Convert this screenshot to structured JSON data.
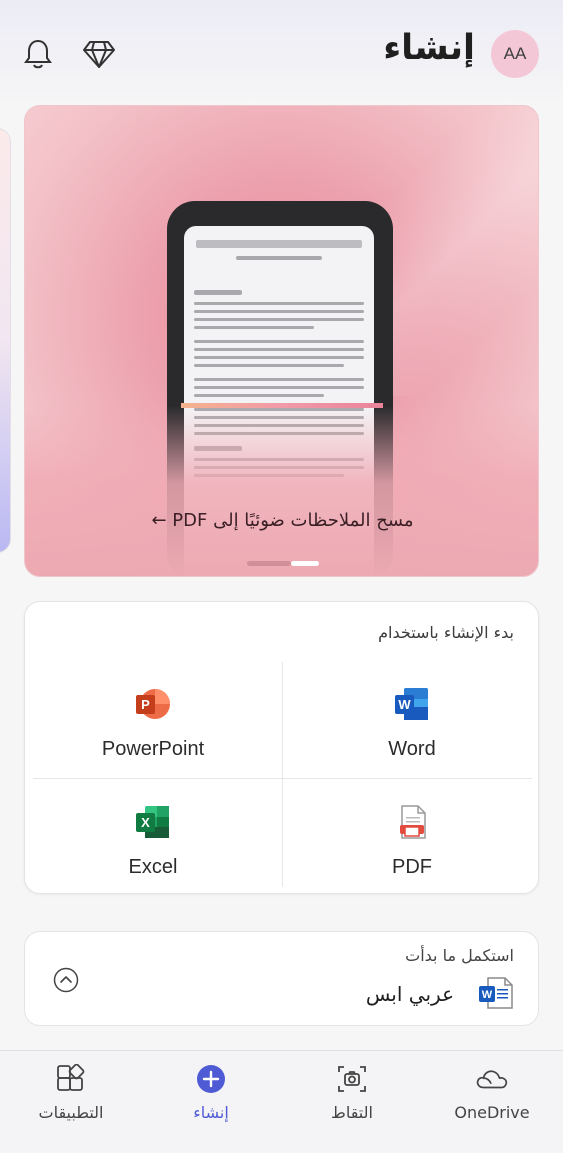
{
  "header": {
    "title": "إنشاء",
    "avatar_initials": "AA",
    "icons": [
      "bell-icon",
      "diamond-icon"
    ]
  },
  "hero": {
    "caption": "مسح الملاحظات ضوئيًا إلى PDF ←",
    "page_indicator": {
      "pages": 2,
      "active": 2
    }
  },
  "create": {
    "heading": "بدء الإنشاء باستخدام",
    "apps": [
      {
        "label": "Word",
        "icon": "word-icon",
        "color": "#2b579a"
      },
      {
        "label": "PowerPoint",
        "icon": "powerpoint-icon",
        "color": "#d24726"
      },
      {
        "label": "PDF",
        "icon": "pdf-icon",
        "color": "#d8443c"
      },
      {
        "label": "Excel",
        "icon": "excel-icon",
        "color": "#217346"
      }
    ]
  },
  "resume": {
    "heading": "استكمل ما بدأت",
    "document_name": "عربي ابس",
    "document_icon": "word-doc-icon"
  },
  "bottom_nav": {
    "items": [
      {
        "label": "OneDrive",
        "icon": "cloud-icon",
        "active": false
      },
      {
        "label": "التقاط",
        "icon": "camera-icon",
        "active": false
      },
      {
        "label": "إنشاء",
        "icon": "plus-circle-icon",
        "active": true
      },
      {
        "label": "التطبيقات",
        "icon": "apps-icon",
        "active": false
      }
    ],
    "accent": "#4f5bd5"
  }
}
